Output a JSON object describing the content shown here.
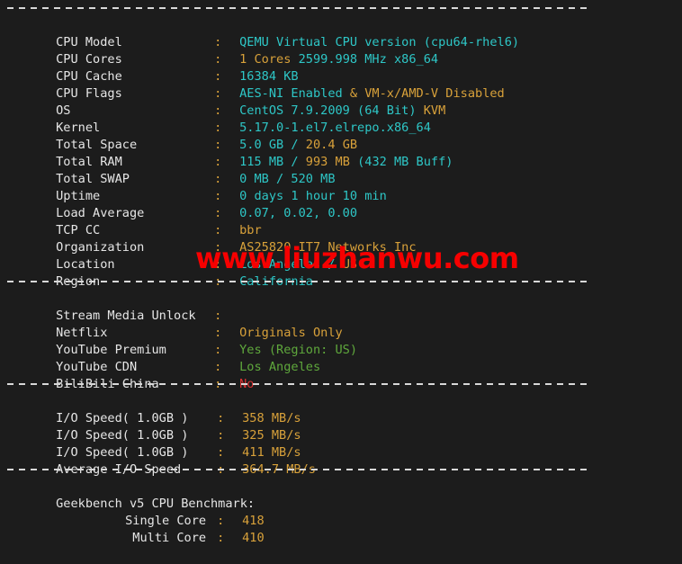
{
  "terminal": {
    "background": "#1c1c1c",
    "label_color": "#e6e6e6",
    "colon": ":",
    "colors": {
      "cyan": "#2ec7c7",
      "orange": "#d8a13a",
      "green": "#5fa83c",
      "red": "#dc3232",
      "white": "#e6e6e6"
    }
  },
  "watermark": {
    "text": "www.liuzhanwu.com",
    "color": "#f60000"
  },
  "system_info": {
    "rows": [
      {
        "label": "CPU Model",
        "value": "QEMU Virtual CPU version (cpu64-rhel6)"
      },
      {
        "label": "CPU Cores",
        "value": "1 Cores 2599.998 MHz x86_64"
      },
      {
        "label": "CPU Cache",
        "value": "16384 KB"
      },
      {
        "label": "CPU Flags",
        "value": "AES-NI Enabled & VM-x/AMD-V Disabled"
      },
      {
        "label": "OS",
        "value": "CentOS 7.9.2009 (64 Bit) KVM"
      },
      {
        "label": "Kernel",
        "value": "5.17.0-1.el7.elrepo.x86_64"
      },
      {
        "label": "Total Space",
        "value": "5.0 GB / 20.4 GB"
      },
      {
        "label": "Total RAM",
        "value": "115 MB / 993 MB (432 MB Buff)"
      },
      {
        "label": "Total SWAP",
        "value": "0 MB / 520 MB"
      },
      {
        "label": "Uptime",
        "value": "0 days 1 hour 10 min"
      },
      {
        "label": "Load Average",
        "value": "0.07, 0.02, 0.00"
      },
      {
        "label": "TCP CC",
        "value": "bbr"
      },
      {
        "label": "Organization",
        "value": "AS25820 IT7 Networks Inc"
      },
      {
        "label": "Location",
        "value": "Los Angeles / US"
      },
      {
        "label": "Region",
        "value": "California"
      }
    ],
    "parts": {
      "cpu_model": {
        "a": "QEMU Virtual CPU version (cpu64-rhel6)"
      },
      "cpu_cores": {
        "a": "1 Cores ",
        "b": "2599.998 MHz x86_64"
      },
      "cpu_cache": {
        "a": "16384 KB"
      },
      "cpu_flags": {
        "a": "AES-NI Enabled ",
        "b": "& VM-x/AMD-V Disabled"
      },
      "os": {
        "a": "CentOS 7.9.2009 (64 Bit) ",
        "b": "KVM"
      },
      "kernel": {
        "a": "5.17.0-1.el7.elrepo.x86_64"
      },
      "total_space": {
        "a": "5.0 GB / ",
        "b": "20.4 GB"
      },
      "total_ram": {
        "a": "115 MB / ",
        "b": "993 MB",
        "c": " (432 MB Buff)"
      },
      "total_swap": {
        "a": "0 MB / ",
        "b": "520 MB"
      },
      "uptime": {
        "a": "0 days 1 hour 10 min"
      },
      "load_average": {
        "a": "0.07, 0.02, 0.00"
      },
      "tcp_cc": {
        "a": "bbr"
      },
      "organization": {
        "a": "AS25820 IT7 Networks Inc"
      },
      "location": {
        "a": "Los Angeles / ",
        "b": "US"
      },
      "region": {
        "a": "California"
      }
    }
  },
  "stream_media": {
    "heading_label": "Stream Media Unlock",
    "heading_value": "",
    "rows": [
      {
        "label": "Netflix",
        "value": "Originals Only"
      },
      {
        "label": "YouTube Premium",
        "value": "Yes (Region: US)"
      },
      {
        "label": "YouTube CDN",
        "value": "Los Angeles"
      },
      {
        "label": "BiliBili China",
        "value": "No"
      }
    ]
  },
  "io_speed": {
    "rows": [
      {
        "label": "I/O Speed( 1.0GB )",
        "value": "358 MB/s"
      },
      {
        "label": "I/O Speed( 1.0GB )",
        "value": "325 MB/s"
      },
      {
        "label": "I/O Speed( 1.0GB )",
        "value": "411 MB/s"
      },
      {
        "label": "Average I/O Speed",
        "value": "364.7 MB/s"
      }
    ]
  },
  "geekbench": {
    "heading": "Geekbench v5 CPU Benchmark:",
    "rows": [
      {
        "label": "Single Core",
        "value": "418"
      },
      {
        "label": "Multi Core",
        "value": "410"
      }
    ]
  }
}
